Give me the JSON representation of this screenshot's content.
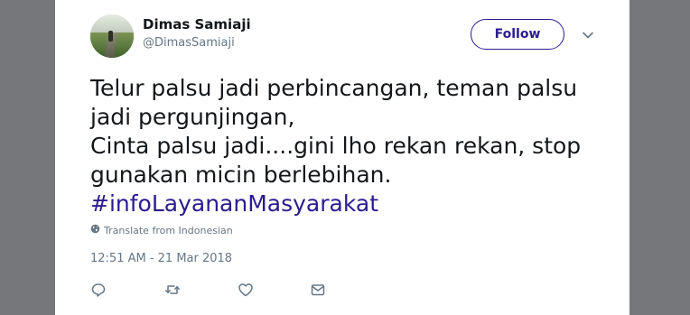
{
  "tweet": {
    "author": {
      "display_name": "Dimas Samiaji",
      "handle": "@DimasSamiaji"
    },
    "follow_label": "Follow",
    "text_lines": [
      "Telur palsu jadi perbincangan, teman palsu",
      "jadi pergunjingan,",
      "Cinta palsu jadi....gini lho rekan rekan, stop",
      "gunakan micin berlebihan."
    ],
    "hashtag": "#infoLayananMasyarakat",
    "translate_label": "Translate from Indonesian",
    "timestamp": "12:51 AM - 21 Mar 2018"
  },
  "icons": {
    "menu": "chevron-down-icon",
    "translate": "globe-icon",
    "reply": "reply-icon",
    "retweet": "retweet-icon",
    "like": "heart-icon",
    "message": "envelope-icon"
  },
  "colors": {
    "accent": "#2a1b8f",
    "secondary_text": "#657786",
    "primary_text": "#14171a",
    "backdrop": "#75777a"
  }
}
